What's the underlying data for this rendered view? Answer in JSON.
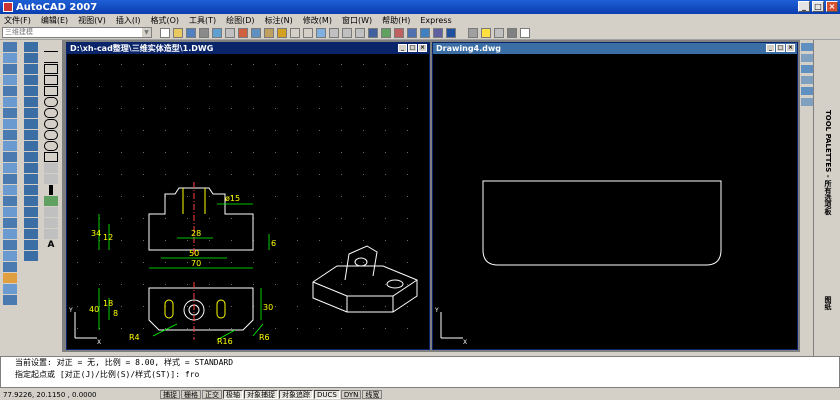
{
  "window": {
    "title": "AutoCAD 2007"
  },
  "menu": [
    "文件(F)",
    "编辑(E)",
    "视图(V)",
    "插入(I)",
    "格式(O)",
    "工具(T)",
    "绘图(D)",
    "标注(N)",
    "修改(M)",
    "窗口(W)",
    "帮助(H)",
    "Express"
  ],
  "toolbar": {
    "workspace": "三维建模"
  },
  "doc1": {
    "title": "D:\\xh-cad整理\\三维实体造型\\1.DWG",
    "dims": [
      "ø15",
      "28",
      "50",
      "70",
      "34",
      "12",
      "6",
      "40",
      "18",
      "8",
      "R4",
      "R16",
      "R6",
      "30"
    ]
  },
  "doc2": {
    "title": "Drawing4.dwg"
  },
  "command": {
    "line1": "当前设置:  对正 = 无, 比例 = 8.00, 样式 = STANDARD",
    "line2": "指定起点或 [对正(J)/比例(S)/样式(ST)]:  fro"
  },
  "status": {
    "coords": "77.9226,  20.1150 , 0.0000",
    "buttons": [
      "捕捉",
      "栅格",
      "正交",
      "极轴",
      "对象捕捉",
      "对象追踪",
      "DUCS",
      "DYN",
      "线宽"
    ]
  },
  "palette": {
    "label": "TOOL PALETTES - 所有选项板",
    "tab": "图纸"
  }
}
